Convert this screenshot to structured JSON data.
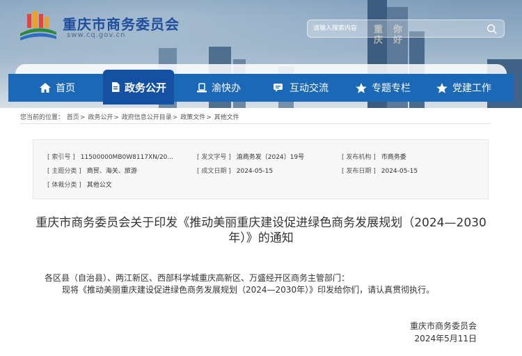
{
  "header": {
    "site_title": "重庆市商务委员会",
    "site_domain": "sww.cq.gov.cn",
    "sign_text_1": "重庆",
    "sign_text_2": "你好"
  },
  "search": {
    "placeholder": "请输入搜索内容"
  },
  "nav": {
    "items": [
      {
        "label": "首页",
        "icon": "home-icon"
      },
      {
        "label": "政务公开",
        "icon": "document-icon",
        "active": true
      },
      {
        "label": "渝快办",
        "icon": "service-icon"
      },
      {
        "label": "互动交流",
        "icon": "chat-icon"
      },
      {
        "label": "专题专栏",
        "icon": "star-icon"
      },
      {
        "label": "党建工作",
        "icon": "star-icon"
      }
    ]
  },
  "breadcrumb": {
    "prefix": "您当前的位置：",
    "items": [
      "首页",
      "政务公开",
      "政府信息公开目录",
      "政策文件",
      "其他文件"
    ],
    "separator": ">"
  },
  "info": {
    "index_label": "[ 索引号 ]",
    "index_value": "11500000MB0W8117XN/20...",
    "docno_label": "[ 发文字号 ]",
    "docno_value": "渝商务发〔2024〕19号",
    "org_label": "[ 发布机构 ]",
    "org_value": "市商务委",
    "topic_label": "[ 主题分类 ]",
    "topic_value": "商贸、海关、旅游",
    "created_label": "[ 成文日期 ]",
    "created_value": "2024-05-15",
    "pub_label": "[ 发布日期 ]",
    "pub_value": "2024-05-15",
    "genre_label": "[ 体裁分类 ]",
    "genre_value": "其他公文"
  },
  "doc": {
    "title": "重庆市商务委员会关于印发《推动美丽重庆建设促进绿色商务发展规划（2024—2030年）》的通知",
    "para1": "各区县（自治县）、两江新区、西部科学城重庆高新区、万盛经开区商务主管部门：",
    "para2": "现将《推动美丽重庆建设促进绿色商务发展规划（2024—2030年）》印发给你们，请认真贯彻执行。",
    "signature": "重庆市商务委员会",
    "date": "2024年5月11日"
  },
  "colors": {
    "nav": "#1b68b7",
    "nav_active": "#1551a3",
    "title_blue": "#1f4f9c"
  }
}
